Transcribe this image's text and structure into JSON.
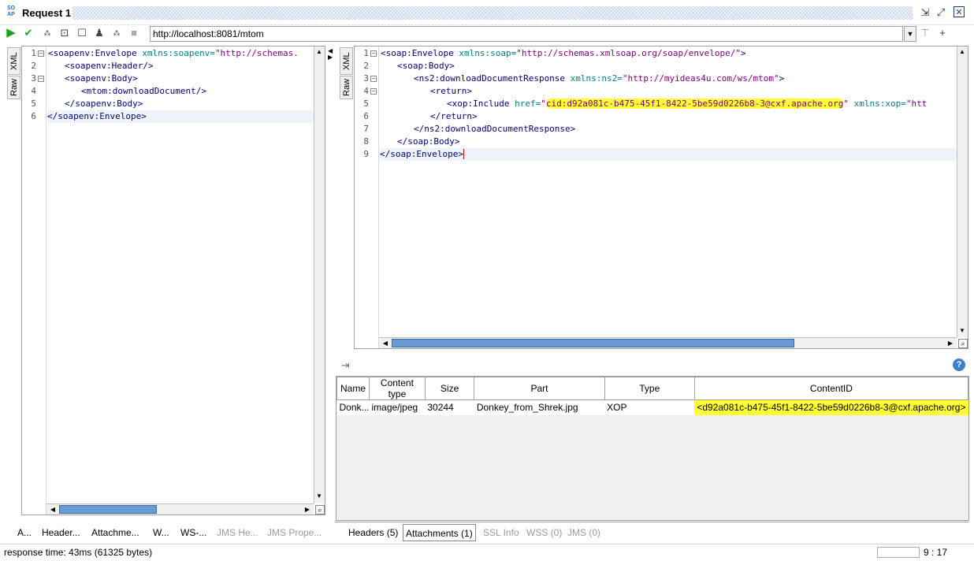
{
  "window": {
    "title": "Request 1",
    "logo_text": "SO AP"
  },
  "toolbar": {
    "url": "http://localhost:8081/mtom",
    "icons": [
      "run-icon",
      "check-icon",
      "encode-icon",
      "frame-icon",
      "square-icon",
      "user-icon",
      "gear-icon",
      "stop-icon"
    ]
  },
  "request": {
    "side_tabs": [
      "XML",
      "Raw"
    ],
    "lines": [
      {
        "n": "1",
        "fold": "−"
      },
      {
        "n": "2",
        "fold": ""
      },
      {
        "n": "3",
        "fold": "−"
      },
      {
        "n": "4",
        "fold": ""
      },
      {
        "n": "5",
        "fold": ""
      },
      {
        "n": "6",
        "fold": ""
      }
    ],
    "code": {
      "l1_tag": "<soapenv:Envelope",
      "l1_attr": " xmlns:soapenv=",
      "l1_str": "\"http://schemas.",
      "l2": "<soapenv:Header/>",
      "l3": "<soapenv:Body>",
      "l4": "<mtom:downloadDocument/>",
      "l5": "</soapenv:Body>",
      "l6": "</soapenv:Envelope>"
    }
  },
  "response": {
    "side_tabs": [
      "XML",
      "Raw"
    ],
    "code": {
      "l1_tag": "<soap:Envelope",
      "l1_attr": " xmlns:soap=",
      "l1_str": "\"http://schemas.xmlsoap.org/soap/envelope/\"",
      "l1_end": ">",
      "l2": "<soap:Body>",
      "l3_tag": "<ns2:downloadDocumentResponse",
      "l3_attr": " xmlns:ns2=",
      "l3_str": "\"http://myideas4u.com/ws/mtom\"",
      "l3_end": ">",
      "l4": "<return>",
      "l5_tag": "<xop:Include",
      "l5_attr": " href=",
      "l5_q": "\"",
      "l5_cid": "cid:d92a081c-b475-45f1-8422-5be59d0226b8-3@cxf.apache.org",
      "l5_q2": "\"",
      "l5_attr2": " xmlns:xop=",
      "l5_str2": "\"htt",
      "l6": "</return>",
      "l7": "</ns2:downloadDocumentResponse>",
      "l8": "</soap:Body>",
      "l9": "</soap:Envelope>"
    },
    "line_numbers": [
      "1",
      "2",
      "3",
      "4",
      "5",
      "6",
      "7",
      "8",
      "9"
    ]
  },
  "attachments": {
    "columns": [
      "Name",
      "Content type",
      "Size",
      "Part",
      "Type",
      "ContentID"
    ],
    "rows": [
      {
        "name": "Donk...",
        "content_type": "image/jpeg",
        "size": "30244",
        "part": "Donkey_from_Shrek.jpg",
        "type": "XOP",
        "content_id": "<d92a081c-b475-45f1-8422-5be59d0226b8-3@cxf.apache.org>"
      }
    ]
  },
  "left_tabs": [
    "A...",
    "Header...",
    "Attachme...",
    "W...",
    "WS-...",
    "JMS He...",
    "JMS Prope..."
  ],
  "right_tabs": [
    "Headers (5)",
    "Attachments (1)",
    "SSL Info",
    "WSS (0)",
    "JMS (0)"
  ],
  "status": {
    "text": "response time: 43ms (61325 bytes)",
    "position": "9 : 17"
  },
  "colors": {
    "highlight": "#ffff33",
    "tag": "#000080",
    "attr": "#008080",
    "string": "#800080"
  }
}
